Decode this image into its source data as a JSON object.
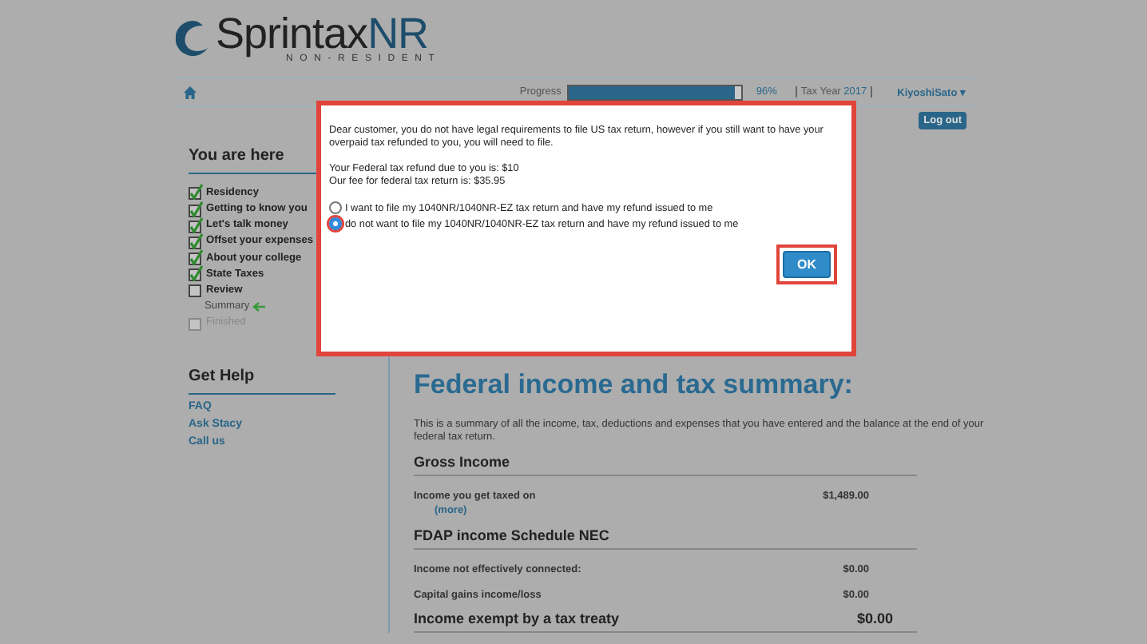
{
  "header": {
    "logo": {
      "name": "Sprintax",
      "suffix": "NR",
      "tagline": "NON-RESIDENT"
    }
  },
  "nav": {
    "progress": {
      "label": "Progress",
      "level": 0.96,
      "reading": "96%"
    },
    "tax_year": {
      "label": "Tax Year",
      "value": "2017"
    },
    "user": "KiyoshiSato",
    "user_caret": "▾",
    "logout": "Log out"
  },
  "sidebar": {
    "title": "You are here",
    "steps": [
      {
        "label": "Residency",
        "kind": "check",
        "checked": true,
        "disabled": false
      },
      {
        "label": "Getting to know you",
        "kind": "check",
        "checked": true,
        "disabled": false
      },
      {
        "label": "Let's talk money",
        "kind": "check",
        "checked": true,
        "disabled": false
      },
      {
        "label": "Offset your expenses",
        "kind": "check",
        "checked": true,
        "disabled": false
      },
      {
        "label": "About your college",
        "kind": "check",
        "checked": true,
        "disabled": false
      },
      {
        "label": "State Taxes",
        "kind": "check",
        "checked": true,
        "disabled": false
      },
      {
        "label": "Review",
        "kind": "check",
        "checked": false,
        "disabled": false
      },
      {
        "label": "Summary",
        "kind": "current"
      },
      {
        "label": "Finished",
        "kind": "check",
        "checked": false,
        "disabled": true
      }
    ],
    "help_title": "Get Help",
    "help_links": [
      "FAQ",
      "Ask Stacy",
      "Call us"
    ]
  },
  "main": {
    "title": "Federal income and tax summary:",
    "intro": "This is a summary of all the income, tax, deductions and expenses that you have entered and the balance at the end of your federal tax return.",
    "sections": [
      {
        "heading": "Gross Income",
        "rows": [
          {
            "label": "Income you get taxed on",
            "value": "$1,489.00",
            "link": "(more)"
          }
        ]
      },
      {
        "heading": "FDAP income Schedule NEC",
        "rows": [
          {
            "label": "Income not effectively connected:",
            "value": "$0.00"
          },
          {
            "label": "Capital gains income/loss",
            "value": "$0.00"
          }
        ]
      },
      {
        "heading": "Income exempt by a tax treaty",
        "value": "$0.00"
      }
    ]
  },
  "modal": {
    "highlighted": true,
    "message": "Dear customer, you do not have legal requirements to file US tax return, however if you still want to have your overpaid tax refunded to you, you will need to file.",
    "lines": [
      "Your Federal tax refund due to you is: $10",
      "Our fee for federal tax return is: $35.95"
    ],
    "options": [
      {
        "label": "I want to file my 1040NR/1040NR-EZ tax return and have my refund issued to me",
        "selected": false,
        "highlighted": false
      },
      {
        "label": "do not want to file my 1040NR/1040NR-EZ tax return and have my refund issued to me",
        "selected": true,
        "highlighted": true
      }
    ],
    "ok_button": {
      "label": "OK",
      "highlighted": true
    }
  }
}
